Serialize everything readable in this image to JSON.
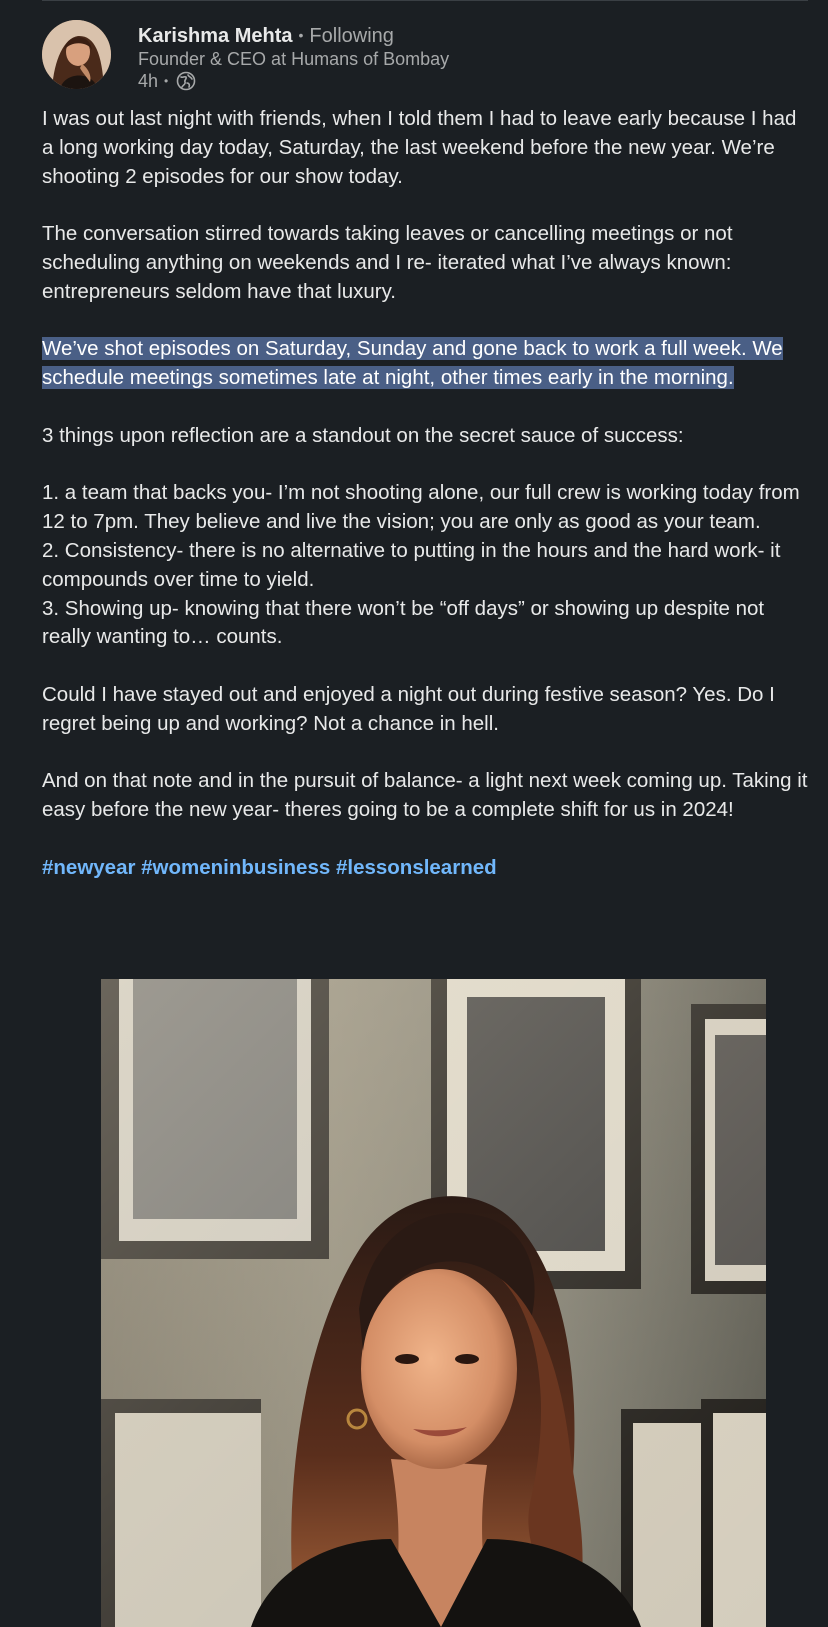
{
  "author": {
    "name": "Karishma Mehta",
    "follow_status": "Following",
    "headline": "Founder & CEO at Humans of Bombay",
    "time": "4h",
    "visibility_icon": "globe-icon"
  },
  "post": {
    "paragraphs": [
      "I was out last night with friends, when I told them I had to leave early because I had a long working day today, Saturday, the last weekend before the new year. We’re shooting 2 episodes for our show today.",
      "The conversation stirred towards taking leaves or cancelling meetings or not scheduling anything on weekends and I re- iterated what I’ve always known: entrepreneurs seldom have that luxury.",
      "We’ve shot episodes on Saturday, Sunday and gone back to work a full week. We schedule meetings sometimes late at night, other times early in the morning.",
      "3 things upon reflection are a standout on the secret sauce of success:",
      "1. a team that backs you- I’m not shooting alone, our full crew is working today from 12 to 7pm. They believe and live the vision; you are only as good as your team.",
      "2. Consistency- there is no alternative to putting in the hours and the hard work- it compounds over time to yield.",
      "3. Showing up- knowing that there won’t be “off days” or showing up despite not really wanting to… counts.",
      "Could I have stayed out and enjoyed a night out during festive season? Yes. Do I regret being up and working? Not a chance in hell.",
      "And on that note and in the pursuit of balance- a light next week coming up. Taking it easy before the new year- theres going to be a complete shift for us in 2024!"
    ],
    "hashtags": [
      "#newyear",
      "#womeninbusiness",
      "#lessonslearned"
    ]
  },
  "colors": {
    "background": "#1b1f23",
    "text": "#e6e6e6",
    "muted": "#a7a9aa",
    "hashtag": "#71b7fb",
    "selection": "#4a5f86"
  }
}
